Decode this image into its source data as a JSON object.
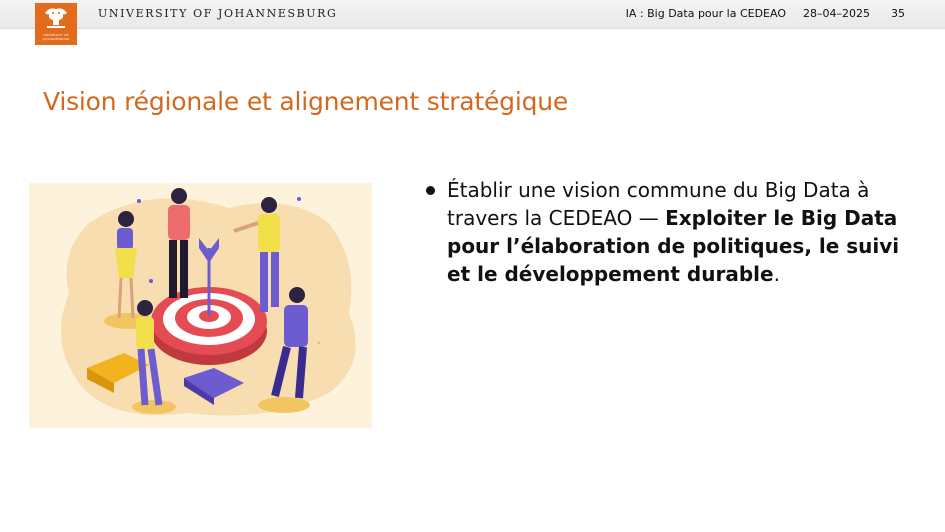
{
  "header": {
    "university": "UNIVERSITY OF JOHANNESBURG",
    "course": "IA : Big Data pour la CEDEAO",
    "date": "28–04–2025",
    "page": "35",
    "logo_caption": "UNIVERSITY OF JOHANNESBURG",
    "logo_color": "#e36b1d"
  },
  "slide": {
    "title": "Vision régionale et alignement stratégique",
    "title_color": "#d2691e",
    "bullet_normal": "Établir une vision commune du Big Data à travers la CEDEAO — ",
    "bullet_bold": "Exploiter le Big Data pour l’élaboration de politiques, le suivi et le développement durable",
    "bullet_end": "."
  },
  "illustration": {
    "icon": "team-target-illustration",
    "background_color": "#fdf3dc"
  }
}
